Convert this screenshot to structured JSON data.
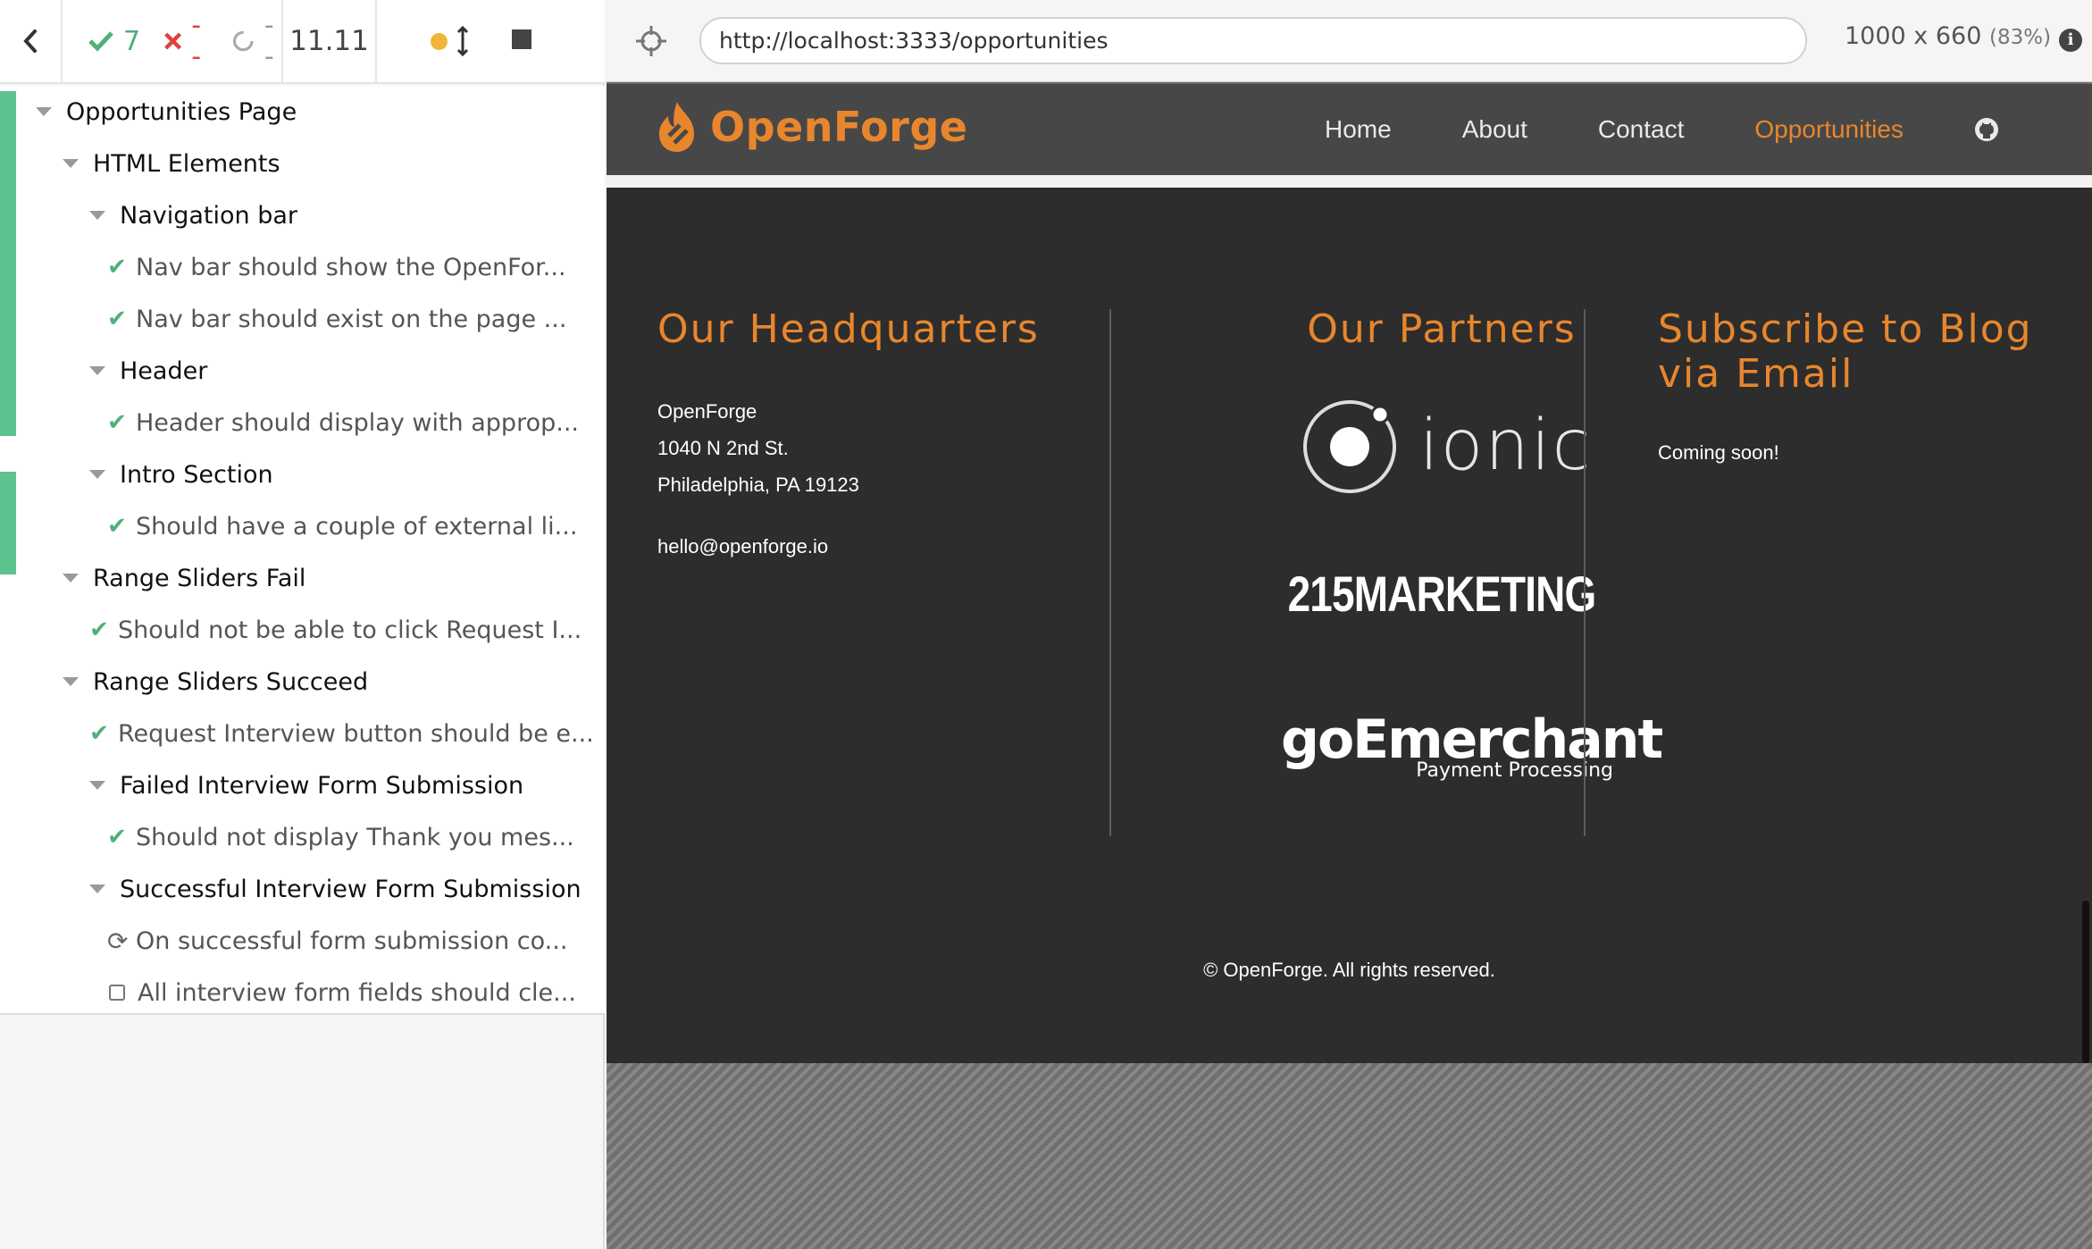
{
  "reporter": {
    "stats": {
      "passed": "7",
      "failed": "--",
      "pending": "--"
    },
    "duration": "11.11"
  },
  "tree": [
    {
      "type": "suite",
      "level": 0,
      "label": "Opportunities Page"
    },
    {
      "type": "suite",
      "level": 1,
      "label": "HTML Elements"
    },
    {
      "type": "suite",
      "level": 2,
      "label": "Navigation bar"
    },
    {
      "type": "test",
      "level": 3,
      "state": "passed",
      "label": "Nav bar should show the OpenFor..."
    },
    {
      "type": "test",
      "level": 3,
      "state": "passed",
      "label": "Nav bar should exist on the page ..."
    },
    {
      "type": "suite",
      "level": 2,
      "label": "Header"
    },
    {
      "type": "test",
      "level": 3,
      "state": "passed",
      "label": "Header should display with approp..."
    },
    {
      "type": "suite",
      "level": 2,
      "label": "Intro Section"
    },
    {
      "type": "test",
      "level": 3,
      "state": "passed",
      "label": "Should have a couple of external li..."
    },
    {
      "type": "suite",
      "level": 1,
      "label": "Range Sliders Fail"
    },
    {
      "type": "test",
      "level": 2,
      "state": "passed",
      "label": "Should not be able to click Request I..."
    },
    {
      "type": "suite",
      "level": 1,
      "label": "Range Sliders Succeed"
    },
    {
      "type": "test",
      "level": 2,
      "state": "passed",
      "label": "Request Interview button should be e..."
    },
    {
      "type": "suite",
      "level": 2,
      "label": "Failed Interview Form Submission"
    },
    {
      "type": "test",
      "level": 3,
      "state": "passed",
      "label": "Should not display Thank you mes..."
    },
    {
      "type": "suite",
      "level": 2,
      "label": "Successful Interview Form Submission"
    },
    {
      "type": "test",
      "level": 3,
      "state": "running",
      "label": "On successful form submission co..."
    },
    {
      "type": "test",
      "level": 3,
      "state": "pending",
      "label": "All interview form fields should cle..."
    }
  ],
  "browser": {
    "url": "http://localhost:3333/opportunities",
    "viewport": "1000 x 660",
    "scale": "(83%)"
  },
  "site": {
    "logo": "OpenForge",
    "nav": [
      "Home",
      "About",
      "Contact",
      "Opportunities"
    ],
    "hq": {
      "title": "Our Headquarters",
      "name": "OpenForge",
      "street": "1040 N 2nd St.",
      "city": "Philadelphia, PA 19123",
      "email": "hello@openforge.io"
    },
    "partners": {
      "title": "Our Partners",
      "ionic": "ionic",
      "marketing": "215MARKETING",
      "goemerchant": "goEmerchant",
      "goemerchant_sub": "Payment Processing"
    },
    "subscribe": {
      "title_line1": "Subscribe to Blog",
      "title_line2": "via Email",
      "text": "Coming soon!"
    },
    "copyright": "© OpenForge. All rights reserved."
  },
  "colors": {
    "accent": "#e8862d",
    "pass": "#4fb07a",
    "fail": "#e0403d",
    "footer_bg": "#2d2d2d",
    "nav_bg": "#474747"
  }
}
